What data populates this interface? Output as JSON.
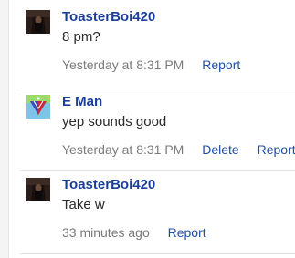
{
  "comments": [
    {
      "author": "ToasterBoi420",
      "avatar": "toaster-avatar",
      "body": "8 pm?",
      "timestamp": "Yesterday at 8:31 PM",
      "actions": [
        "Report"
      ]
    },
    {
      "author": "E Man",
      "avatar": "gem-avatar",
      "body": "yep sounds good",
      "timestamp": "Yesterday at 8:31 PM",
      "actions": [
        "Delete",
        "Report"
      ]
    },
    {
      "author": "ToasterBoi420",
      "avatar": "toaster-avatar",
      "body": "Take w",
      "timestamp": "33 minutes ago",
      "actions": [
        "Report"
      ]
    }
  ],
  "colors": {
    "author": "#1a3f9a",
    "link": "#1f4fa8",
    "meta": "#7a7a7a",
    "divider": "#e2e2e2"
  }
}
